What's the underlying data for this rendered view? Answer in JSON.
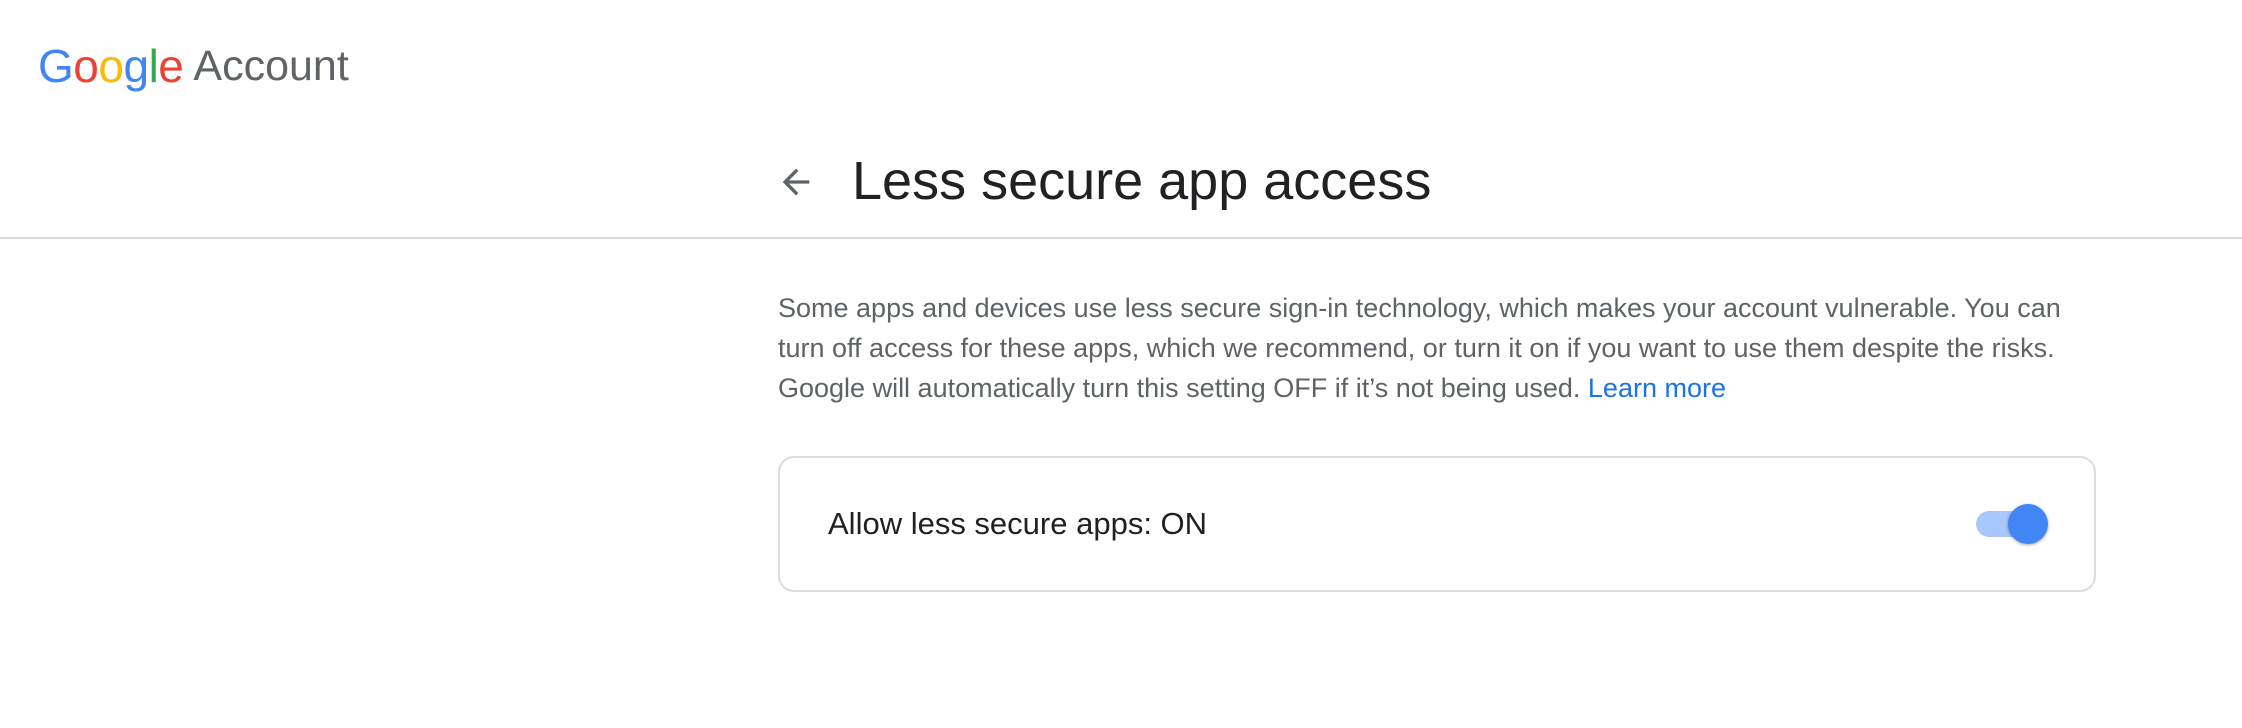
{
  "header": {
    "logo_letters": [
      {
        "char": "G",
        "color": "#4285F4"
      },
      {
        "char": "o",
        "color": "#EA4335"
      },
      {
        "char": "o",
        "color": "#FBBC05"
      },
      {
        "char": "g",
        "color": "#4285F4"
      },
      {
        "char": "l",
        "color": "#34A853"
      },
      {
        "char": "e",
        "color": "#EA4335"
      }
    ],
    "logo_G": "G",
    "logo_o1": "o",
    "logo_o2": "o",
    "logo_g": "g",
    "logo_l": "l",
    "logo_e": "e",
    "product_name": "Account"
  },
  "page": {
    "back_icon": "arrow-back-icon",
    "title": "Less secure app access"
  },
  "description": {
    "text": "Some apps and devices use less secure sign-in technology, which makes your account vulnerable. You can turn off access for these apps, which we recommend, or turn it on if you want to use them despite the risks. Google will automatically turn this setting OFF if it’s not being used.",
    "link_label": "Learn more"
  },
  "setting": {
    "label": "Allow less secure apps: ON",
    "enabled": true
  },
  "colors": {
    "accent": "#1a73e8",
    "toggle_on": "#4285f4",
    "toggle_track_on": "#a8c7fa",
    "divider": "#dadce0",
    "text_primary": "#202124",
    "text_secondary": "#5f6368"
  }
}
